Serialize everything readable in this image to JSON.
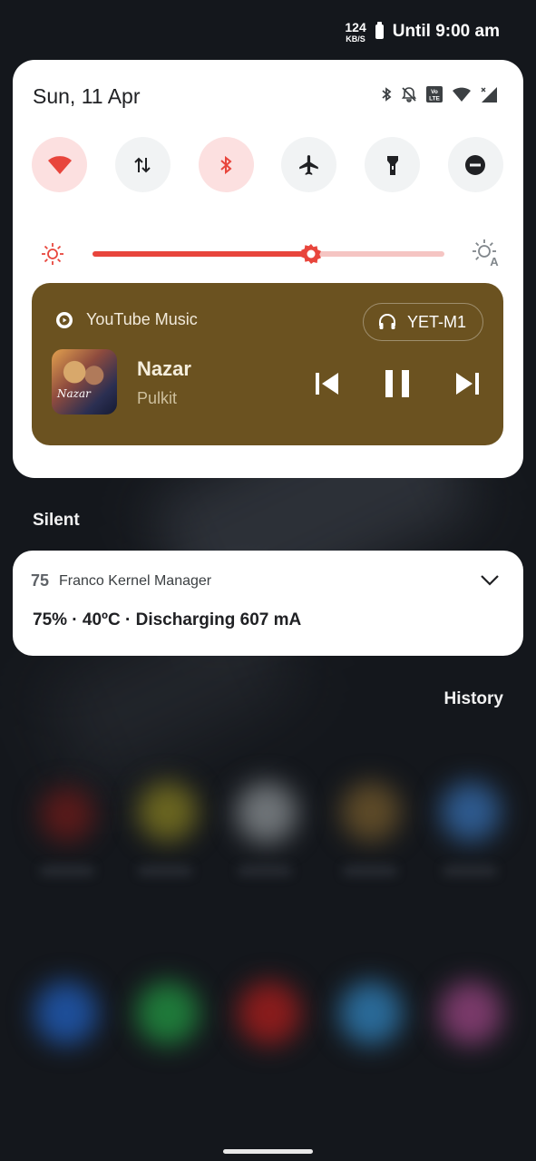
{
  "status_bar": {
    "net_speed_value": "124",
    "net_speed_unit": "KB/S",
    "battery_text": "Until 9:00 am"
  },
  "quick_settings": {
    "date": "Sun, 11 Apr",
    "tiles": [
      {
        "name": "wifi",
        "icon": "wifi-icon",
        "active": true
      },
      {
        "name": "mobile-data",
        "icon": "data-arrows-icon",
        "active": false
      },
      {
        "name": "bluetooth",
        "icon": "bluetooth-icon",
        "active": true
      },
      {
        "name": "airplane-mode",
        "icon": "airplane-icon",
        "active": false
      },
      {
        "name": "flashlight",
        "icon": "flashlight-icon",
        "active": false
      },
      {
        "name": "do-not-disturb",
        "icon": "dnd-icon",
        "active": false
      }
    ],
    "brightness_level": 0.62,
    "accent_color": "#e8453c"
  },
  "media": {
    "app_name": "YouTube Music",
    "device": "YET-M1",
    "track": "Nazar",
    "artist": "Pulkit",
    "album_art_text": "Nazar",
    "background_color": "#6b5220"
  },
  "sections": {
    "silent_label": "Silent",
    "history_label": "History"
  },
  "notification": {
    "badge": "75",
    "app_name": "Franco Kernel Manager",
    "text": "75% · 40ºC · Discharging 607 mA"
  }
}
